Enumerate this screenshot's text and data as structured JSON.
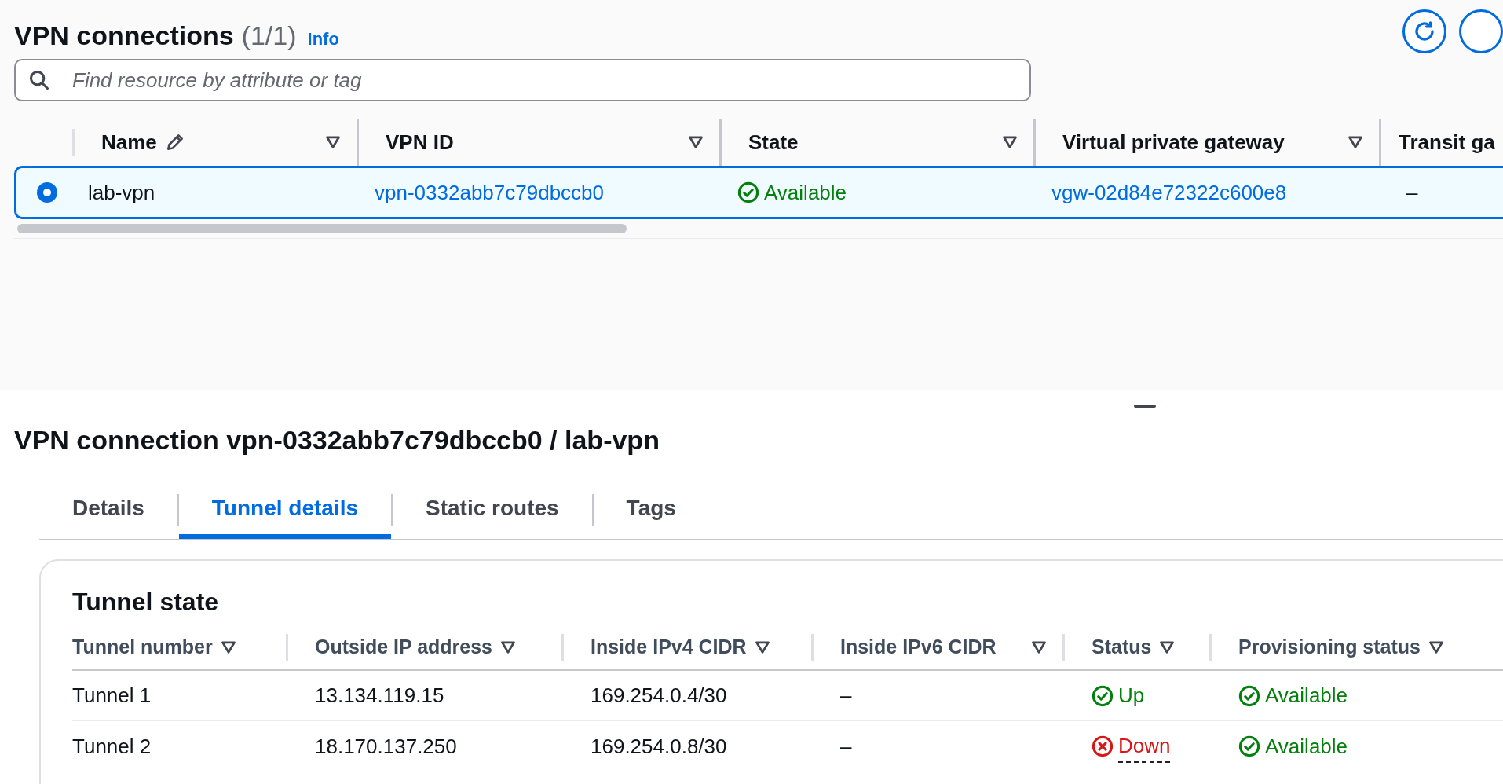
{
  "header": {
    "title": "VPN connections",
    "count": "(1/1)",
    "info": "Info"
  },
  "search": {
    "placeholder": "Find resource by attribute or tag"
  },
  "table": {
    "columns": [
      {
        "label": "Name",
        "editable": true,
        "sortable": true
      },
      {
        "label": "VPN ID",
        "editable": false,
        "sortable": true
      },
      {
        "label": "State",
        "editable": false,
        "sortable": true
      },
      {
        "label": "Virtual private gateway",
        "editable": false,
        "sortable": true
      },
      {
        "label": "Transit ga"
      }
    ],
    "rows": [
      {
        "selected": true,
        "name": "lab-vpn",
        "vpn_id": "vpn-0332abb7c79dbccb0",
        "state": {
          "label": "Available",
          "kind": "success"
        },
        "gateway": "vgw-02d84e72322c600e8",
        "transit": "–"
      }
    ]
  },
  "detail": {
    "title": "VPN connection vpn-0332abb7c79dbccb0 / lab-vpn",
    "tabs": [
      {
        "label": "Details",
        "selected": false
      },
      {
        "label": "Tunnel details",
        "selected": true
      },
      {
        "label": "Static routes",
        "selected": false
      },
      {
        "label": "Tags",
        "selected": false
      }
    ],
    "card_title": "Tunnel state",
    "columns": [
      "Tunnel number",
      "Outside IP address",
      "Inside IPv4 CIDR",
      "Inside IPv6 CIDR",
      "Status",
      "Provisioning status"
    ],
    "rows": [
      {
        "tunnel": "Tunnel 1",
        "outside_ip": "13.134.119.15",
        "ipv4": "169.254.0.4/30",
        "ipv6": "–",
        "status": {
          "label": "Up",
          "kind": "success"
        },
        "provisioning": {
          "label": "Available",
          "kind": "success"
        }
      },
      {
        "tunnel": "Tunnel 2",
        "outside_ip": "18.170.137.250",
        "ipv4": "169.254.0.8/30",
        "ipv6": "–",
        "status": {
          "label": "Down",
          "kind": "error"
        },
        "provisioning": {
          "label": "Available",
          "kind": "success"
        }
      }
    ]
  }
}
